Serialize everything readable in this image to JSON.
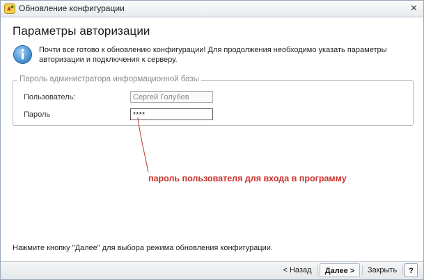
{
  "window": {
    "title": "Обновление конфигурации",
    "close_glyph": "✕"
  },
  "header": {
    "title": "Параметры авторизации",
    "info_text": "Почти все готово к обновлению конфигурации! Для продолжения необходимо указать параметры авторизации и подключения к серверу."
  },
  "auth_group": {
    "legend": "Пароль администратора информационной базы",
    "user_label": "Пользователь:",
    "user_value": "Сергей Голубев",
    "password_label": "Пароль",
    "password_value": "****"
  },
  "annotation": {
    "text": "пароль пользователя для входа в программу",
    "color": "#c8322c"
  },
  "footer": {
    "hint": "Нажмите кнопку \"Далее\" для выбора режима обновления конфигурации.",
    "back_label": "< Назад",
    "next_label": "Далее >",
    "close_label": "Закрыть",
    "help_label": "?"
  },
  "icons": {
    "app": "1c-app-icon",
    "info": "info-icon",
    "close": "close-icon"
  }
}
